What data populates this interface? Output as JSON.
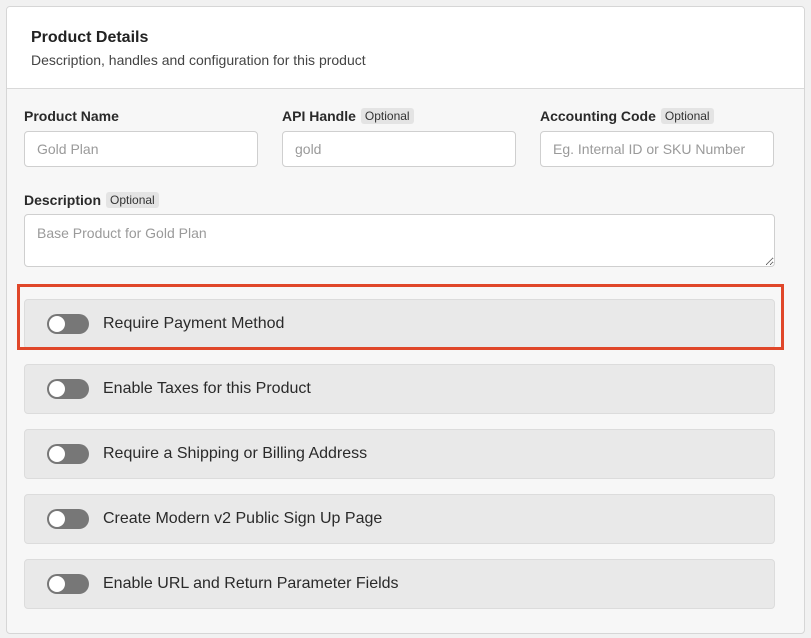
{
  "header": {
    "title": "Product Details",
    "subtitle": "Description, handles and configuration for this product"
  },
  "fields": {
    "product_name": {
      "label": "Product Name",
      "placeholder": "Gold Plan",
      "value": ""
    },
    "api_handle": {
      "label": "API Handle",
      "badge": "Optional",
      "placeholder": "gold",
      "value": ""
    },
    "accounting_code": {
      "label": "Accounting Code",
      "badge": "Optional",
      "placeholder": "Eg. Internal ID or SKU Number",
      "value": ""
    },
    "description": {
      "label": "Description",
      "badge": "Optional",
      "placeholder": "Base Product for Gold Plan",
      "value": ""
    }
  },
  "toggles": [
    {
      "label": "Require Payment Method",
      "enabled": false,
      "highlighted": true
    },
    {
      "label": "Enable Taxes for this Product",
      "enabled": false
    },
    {
      "label": "Require a Shipping or Billing Address",
      "enabled": false
    },
    {
      "label": "Create Modern v2 Public Sign Up Page",
      "enabled": false
    },
    {
      "label": "Enable URL and Return Parameter Fields",
      "enabled": false
    }
  ],
  "colors": {
    "highlight": "#e0472a",
    "toggle_off": "#777777",
    "row_background": "#e9e9e9"
  }
}
